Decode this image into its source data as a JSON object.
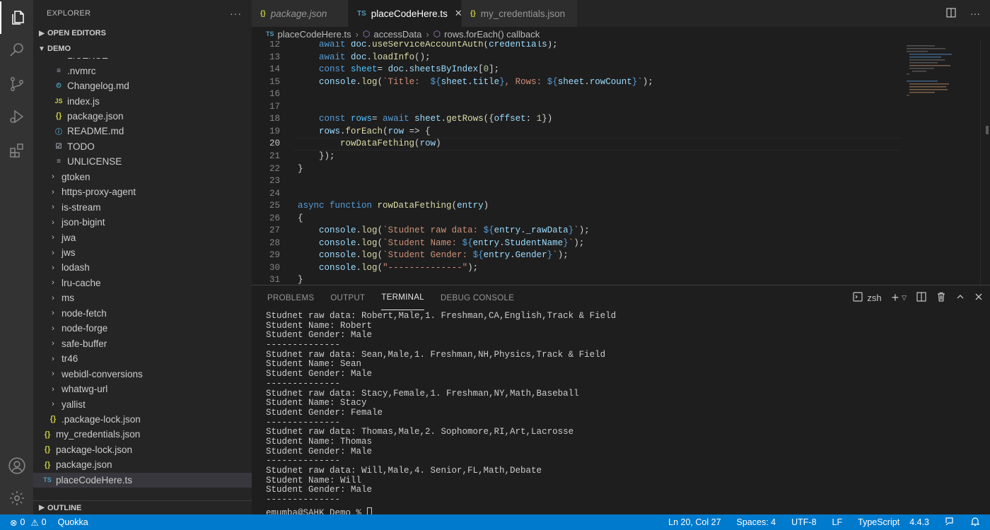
{
  "activity_bar": {
    "items": [
      "files-icon",
      "search-icon",
      "source-control-icon",
      "run-debug-icon",
      "extensions-icon"
    ],
    "bottom": [
      "account-icon",
      "settings-gear-icon"
    ]
  },
  "sidebar": {
    "title": "EXPLORER",
    "more": "···",
    "open_editors": "OPEN EDITORS",
    "folder": "DEMO",
    "outline": "OUTLINE",
    "items": [
      {
        "label": "LICENSE",
        "icon": "≡",
        "kind": "gray",
        "indent": 2
      },
      {
        "label": ".nvmrc",
        "icon": "≡",
        "kind": "gray",
        "indent": 2
      },
      {
        "label": "Changelog.md",
        "icon": "⏲",
        "kind": "md",
        "indent": 2
      },
      {
        "label": "index.js",
        "icon": "JS",
        "kind": "js",
        "indent": 2
      },
      {
        "label": "package.json",
        "icon": "{}",
        "kind": "json",
        "indent": 2
      },
      {
        "label": "README.md",
        "icon": "ⓘ",
        "kind": "md",
        "indent": 2
      },
      {
        "label": "TODO",
        "icon": "☑",
        "kind": "gray",
        "indent": 2
      },
      {
        "label": "UNLICENSE",
        "icon": "≡",
        "kind": "gray",
        "indent": 2
      },
      {
        "label": "gtoken",
        "icon": "›",
        "kind": "chev",
        "indent": 1
      },
      {
        "label": "https-proxy-agent",
        "icon": "›",
        "kind": "chev",
        "indent": 1
      },
      {
        "label": "is-stream",
        "icon": "›",
        "kind": "chev",
        "indent": 1
      },
      {
        "label": "json-bigint",
        "icon": "›",
        "kind": "chev",
        "indent": 1
      },
      {
        "label": "jwa",
        "icon": "›",
        "kind": "chev",
        "indent": 1
      },
      {
        "label": "jws",
        "icon": "›",
        "kind": "chev",
        "indent": 1
      },
      {
        "label": "lodash",
        "icon": "›",
        "kind": "chev",
        "indent": 1
      },
      {
        "label": "lru-cache",
        "icon": "›",
        "kind": "chev",
        "indent": 1
      },
      {
        "label": "ms",
        "icon": "›",
        "kind": "chev",
        "indent": 1
      },
      {
        "label": "node-fetch",
        "icon": "›",
        "kind": "chev",
        "indent": 1
      },
      {
        "label": "node-forge",
        "icon": "›",
        "kind": "chev",
        "indent": 1
      },
      {
        "label": "safe-buffer",
        "icon": "›",
        "kind": "chev",
        "indent": 1
      },
      {
        "label": "tr46",
        "icon": "›",
        "kind": "chev",
        "indent": 1
      },
      {
        "label": "webidl-conversions",
        "icon": "›",
        "kind": "chev",
        "indent": 1
      },
      {
        "label": "whatwg-url",
        "icon": "›",
        "kind": "chev",
        "indent": 1
      },
      {
        "label": "yallist",
        "icon": "›",
        "kind": "chev",
        "indent": 1
      },
      {
        "label": ".package-lock.json",
        "icon": "{}",
        "kind": "json",
        "indent": 1
      },
      {
        "label": "my_credentials.json",
        "icon": "{}",
        "kind": "json",
        "indent": 0
      },
      {
        "label": "package-lock.json",
        "icon": "{}",
        "kind": "json",
        "indent": 0
      },
      {
        "label": "package.json",
        "icon": "{}",
        "kind": "json",
        "indent": 0
      },
      {
        "label": "placeCodeHere.ts",
        "icon": "TS",
        "kind": "ts",
        "indent": 0,
        "selected": true
      }
    ]
  },
  "tabs": [
    {
      "label": "package.json",
      "icon": "{}",
      "kind": "json",
      "italic": true,
      "active": false
    },
    {
      "label": "placeCodeHere.ts",
      "icon": "TS",
      "kind": "ts",
      "italic": false,
      "active": true,
      "close": "✕"
    },
    {
      "label": "my_credentials.json",
      "icon": "{}",
      "kind": "json",
      "italic": false,
      "active": false
    }
  ],
  "breadcrumb": {
    "file_icon": "TS",
    "file": "placeCodeHere.ts",
    "sep": "›",
    "symbol1": "accessData",
    "symbol2": "rows.forEach() callback"
  },
  "editor": {
    "current_line": 20,
    "lines": [
      {
        "n": "12",
        "t": [
          [
            "    ",
            ""
          ],
          [
            "await ",
            "kw"
          ],
          [
            "doc",
            "vr"
          ],
          [
            ".",
            ""
          ],
          [
            "useServiceAccountAuth",
            "fn"
          ],
          [
            "(",
            ""
          ],
          [
            "credentials",
            "vr"
          ],
          [
            ");",
            ""
          ]
        ]
      },
      {
        "n": "13",
        "t": [
          [
            "    ",
            ""
          ],
          [
            "await ",
            "kw"
          ],
          [
            "doc",
            "vr"
          ],
          [
            ".",
            ""
          ],
          [
            "loadInfo",
            "fn"
          ],
          [
            "();",
            ""
          ]
        ]
      },
      {
        "n": "14",
        "t": [
          [
            "    ",
            ""
          ],
          [
            "const ",
            "kw"
          ],
          [
            "sheet",
            "cn"
          ],
          [
            "= ",
            ""
          ],
          [
            "doc",
            "vr"
          ],
          [
            ".",
            ""
          ],
          [
            "sheetsByIndex",
            "vr"
          ],
          [
            "[",
            ""
          ],
          [
            "0",
            "nm"
          ],
          [
            "];",
            ""
          ]
        ]
      },
      {
        "n": "15",
        "t": [
          [
            "    ",
            ""
          ],
          [
            "console",
            "vr"
          ],
          [
            ".",
            ""
          ],
          [
            "log",
            "fn"
          ],
          [
            "(",
            ""
          ],
          [
            "`Title:  ",
            "st"
          ],
          [
            "${",
            "kw"
          ],
          [
            "sheet",
            "vr"
          ],
          [
            ".",
            ""
          ],
          [
            "title",
            "vr"
          ],
          [
            "}",
            "kw"
          ],
          [
            ", Rows: ",
            "st"
          ],
          [
            "${",
            "kw"
          ],
          [
            "sheet",
            "vr"
          ],
          [
            ".",
            ""
          ],
          [
            "rowCount",
            "vr"
          ],
          [
            "}",
            "kw"
          ],
          [
            "`",
            "st"
          ],
          [
            ");",
            ""
          ]
        ]
      },
      {
        "n": "16",
        "t": []
      },
      {
        "n": "17",
        "t": []
      },
      {
        "n": "18",
        "t": [
          [
            "    ",
            ""
          ],
          [
            "const ",
            "kw"
          ],
          [
            "rows",
            "cn"
          ],
          [
            "= ",
            ""
          ],
          [
            "await ",
            "kw"
          ],
          [
            "sheet",
            "vr"
          ],
          [
            ".",
            ""
          ],
          [
            "getRows",
            "fn"
          ],
          [
            "({",
            ""
          ],
          [
            "offset",
            "vr"
          ],
          [
            ": ",
            ""
          ],
          [
            "1",
            "nm"
          ],
          [
            "})",
            ""
          ]
        ]
      },
      {
        "n": "19",
        "t": [
          [
            "    ",
            ""
          ],
          [
            "rows",
            "vr"
          ],
          [
            ".",
            ""
          ],
          [
            "forEach",
            "fn"
          ],
          [
            "(",
            ""
          ],
          [
            "row",
            "vr"
          ],
          [
            " => ",
            ""
          ],
          [
            "{",
            ""
          ]
        ]
      },
      {
        "n": "20",
        "t": [
          [
            "        ",
            ""
          ],
          [
            "rowDataFething",
            "fn"
          ],
          [
            "(",
            ""
          ],
          [
            "row",
            "vr"
          ],
          [
            ")",
            ""
          ]
        ]
      },
      {
        "n": "21",
        "t": [
          [
            "    ",
            ""
          ],
          [
            "});",
            ""
          ]
        ]
      },
      {
        "n": "22",
        "t": [
          [
            "}",
            ""
          ]
        ]
      },
      {
        "n": "23",
        "t": []
      },
      {
        "n": "24",
        "t": []
      },
      {
        "n": "25",
        "t": [
          [
            "async ",
            "kw"
          ],
          [
            "function ",
            "kw"
          ],
          [
            "rowDataFething",
            "fn"
          ],
          [
            "(",
            ""
          ],
          [
            "entry",
            "vr"
          ],
          [
            ")",
            ""
          ]
        ]
      },
      {
        "n": "26",
        "t": [
          [
            "{",
            ""
          ]
        ]
      },
      {
        "n": "27",
        "t": [
          [
            "    ",
            ""
          ],
          [
            "console",
            "vr"
          ],
          [
            ".",
            ""
          ],
          [
            "log",
            "fn"
          ],
          [
            "(",
            ""
          ],
          [
            "`Studnet raw data: ",
            "st"
          ],
          [
            "${",
            "kw"
          ],
          [
            "entry",
            "vr"
          ],
          [
            ".",
            ""
          ],
          [
            "_rawData",
            "vr"
          ],
          [
            "}",
            "kw"
          ],
          [
            "`",
            "st"
          ],
          [
            ");",
            ""
          ]
        ]
      },
      {
        "n": "28",
        "t": [
          [
            "    ",
            ""
          ],
          [
            "console",
            "vr"
          ],
          [
            ".",
            ""
          ],
          [
            "log",
            "fn"
          ],
          [
            "(",
            ""
          ],
          [
            "`Student Name: ",
            "st"
          ],
          [
            "${",
            "kw"
          ],
          [
            "entry",
            "vr"
          ],
          [
            ".",
            ""
          ],
          [
            "StudentName",
            "vr"
          ],
          [
            "}",
            "kw"
          ],
          [
            "`",
            "st"
          ],
          [
            ");",
            ""
          ]
        ]
      },
      {
        "n": "29",
        "t": [
          [
            "    ",
            ""
          ],
          [
            "console",
            "vr"
          ],
          [
            ".",
            ""
          ],
          [
            "log",
            "fn"
          ],
          [
            "(",
            ""
          ],
          [
            "`Student Gender: ",
            "st"
          ],
          [
            "${",
            "kw"
          ],
          [
            "entry",
            "vr"
          ],
          [
            ".",
            ""
          ],
          [
            "Gender",
            "vr"
          ],
          [
            "}",
            "kw"
          ],
          [
            "`",
            "st"
          ],
          [
            ");",
            ""
          ]
        ]
      },
      {
        "n": "30",
        "t": [
          [
            "    ",
            ""
          ],
          [
            "console",
            "vr"
          ],
          [
            ".",
            ""
          ],
          [
            "log",
            "fn"
          ],
          [
            "(",
            ""
          ],
          [
            "\"--------------\"",
            "st"
          ],
          [
            ");",
            ""
          ]
        ]
      },
      {
        "n": "31",
        "t": [
          [
            "}",
            ""
          ]
        ]
      }
    ]
  },
  "panel": {
    "tabs": [
      "PROBLEMS",
      "OUTPUT",
      "TERMINAL",
      "DEBUG CONSOLE"
    ],
    "active_tab": "TERMINAL",
    "shell": "zsh",
    "terminal_lines": [
      "Studnet raw data: Robert,Male,1. Freshman,CA,English,Track & Field",
      "Student Name: Robert",
      "Student Gender: Male",
      "--------------",
      "Studnet raw data: Sean,Male,1. Freshman,NH,Physics,Track & Field",
      "Student Name: Sean",
      "Student Gender: Male",
      "--------------",
      "Studnet raw data: Stacy,Female,1. Freshman,NY,Math,Baseball",
      "Student Name: Stacy",
      "Student Gender: Female",
      "--------------",
      "Studnet raw data: Thomas,Male,2. Sophomore,RI,Art,Lacrosse",
      "Student Name: Thomas",
      "Student Gender: Male",
      "--------------",
      "Studnet raw data: Will,Male,4. Senior,FL,Math,Debate",
      "Student Name: Will",
      "Student Gender: Male",
      "--------------"
    ],
    "prompt": "emumba@SAHK Demo % "
  },
  "status": {
    "errors": "0",
    "warnings": "0",
    "quokka": "Quokka",
    "position": "Ln 20, Col 27",
    "spaces": "Spaces: 4",
    "encoding": "UTF-8",
    "eol": "LF",
    "language": "TypeScript",
    "version": "4.4.3"
  },
  "colors": {
    "status_bar": "#007acc",
    "activity_bar": "#333333",
    "sidebar": "#252526",
    "editor": "#1e1e1e"
  }
}
